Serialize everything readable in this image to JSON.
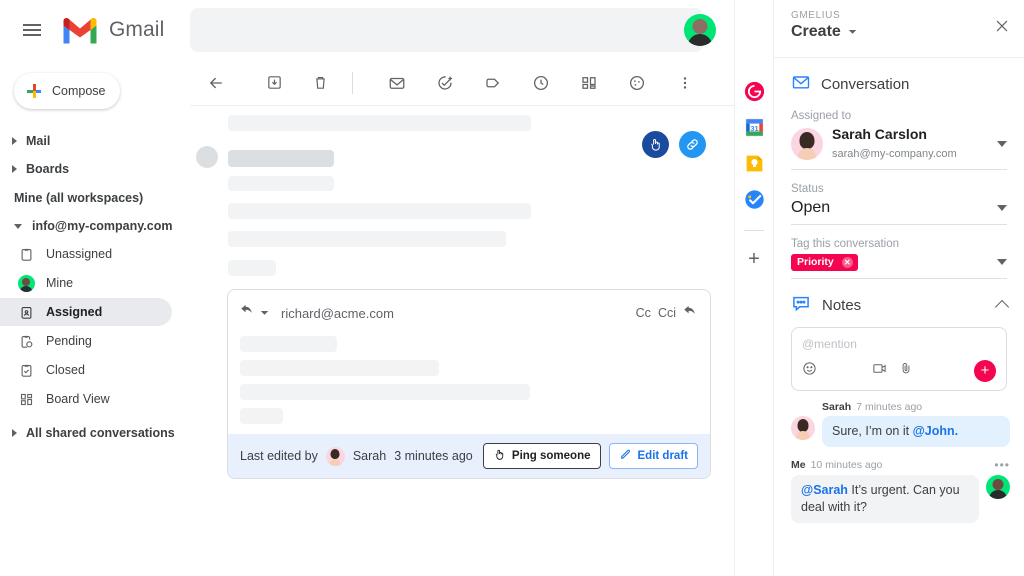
{
  "colors": {
    "gmail_red": "#EA4335",
    "gmail_blue": "#4285F4",
    "gmail_green": "#34A853",
    "gmail_yellow": "#FBBC05",
    "accent_pink": "#F5054F",
    "accent_blue": "#1A73E8",
    "panel_border": "#ECEFF1",
    "badge_dark": "#1A4B9E",
    "badge_light": "#2196F3"
  },
  "topbar": {
    "menu_icon": "hamburger-icon",
    "logo_icon": "gmail-logo-icon",
    "brand": "Gmail",
    "search_value": "",
    "search_placeholder": "",
    "avatar_icon": "account-avatar"
  },
  "sidebar": {
    "compose_label": "Compose",
    "compose_icon": "plus-icon",
    "groups": [
      {
        "label": "Mail",
        "icon": "chevron-right-icon"
      },
      {
        "label": "Boards",
        "icon": "chevron-right-icon"
      }
    ],
    "section_label": "Mine (all workspaces)",
    "workspace": {
      "label": "info@my-company.com",
      "icon": "chevron-down-icon"
    },
    "items": [
      {
        "label": "Unassigned",
        "icon": "clipboard-icon",
        "active": false
      },
      {
        "label": "Mine",
        "icon": "user-avatar-icon",
        "active": false
      },
      {
        "label": "Assigned",
        "icon": "clipboard-person-icon",
        "active": true
      },
      {
        "label": "Pending",
        "icon": "clipboard-clock-icon",
        "active": false
      },
      {
        "label": "Closed",
        "icon": "clipboard-check-icon",
        "active": false
      },
      {
        "label": "Board View",
        "icon": "board-view-icon",
        "active": false
      }
    ],
    "footer_group": {
      "label": "All shared conversations",
      "icon": "chevron-right-icon"
    }
  },
  "toolbar": {
    "buttons": [
      {
        "name": "back-button",
        "icon": "arrow-left-icon"
      },
      {
        "name": "archive-button",
        "icon": "archive-icon"
      },
      {
        "name": "delete-button",
        "icon": "trash-icon"
      },
      {
        "name": "mark-unread-button",
        "icon": "envelope-icon"
      },
      {
        "name": "assign-button",
        "icon": "check-circle-plus-icon"
      },
      {
        "name": "label-button",
        "icon": "tag-icon"
      },
      {
        "name": "snooze-button",
        "icon": "clock-icon"
      },
      {
        "name": "board-button",
        "icon": "kanban-icon"
      },
      {
        "name": "sequence-button",
        "icon": "palette-icon"
      },
      {
        "name": "more-button",
        "icon": "more-vertical-icon"
      }
    ]
  },
  "thread": {
    "badges": [
      {
        "name": "ping-badge",
        "icon": "ping-hand-icon"
      },
      {
        "name": "shared-link-badge",
        "icon": "link-icon"
      }
    ]
  },
  "draft": {
    "reply_icon": "reply-arrow-icon",
    "reply_caret_icon": "chevron-down-icon",
    "recipient": "richard@acme.com",
    "cc_label": "Cc",
    "bcc_label": "Cci",
    "reply_all_icon": "reply-arrow-icon",
    "footer_text_before": "Last edited by",
    "footer_author": "Sarah",
    "footer_text_after": "3 minutes ago",
    "ping_button": {
      "label": "Ping someone",
      "icon": "ping-hand-icon"
    },
    "edit_button": {
      "label": "Edit draft",
      "icon": "pencil-icon"
    }
  },
  "rail": {
    "items": [
      {
        "name": "gmelius-addon",
        "icon": "gmelius-icon"
      },
      {
        "name": "google-calendar-addon",
        "icon": "calendar-31-icon"
      },
      {
        "name": "google-keep-addon",
        "icon": "keep-bulb-icon"
      },
      {
        "name": "google-tasks-addon",
        "icon": "tasks-icon"
      }
    ],
    "add_label": "+",
    "add_icon": "plus-icon"
  },
  "panel": {
    "brand": "GMELIUS",
    "title": "Create",
    "title_caret_icon": "chevron-down-icon",
    "close_icon": "close-icon",
    "conversation": {
      "label": "Conversation",
      "icon": "envelope-icon"
    },
    "assigned": {
      "label": "Assigned to",
      "name": "Sarah Carslon",
      "email": "sarah@my-company.com",
      "avatar_icon": "user-avatar-icon",
      "caret_icon": "chevron-down-icon"
    },
    "status": {
      "label": "Status",
      "value": "Open",
      "caret_icon": "chevron-down-icon"
    },
    "tag": {
      "label": "Tag this conversation",
      "chip": "Priority",
      "chip_color": "#F5054F",
      "remove_icon": "close-circle-icon",
      "caret_icon": "chevron-down-icon"
    },
    "notes": {
      "title": "Notes",
      "icon": "comment-icon",
      "collapse_icon": "chevron-up-icon",
      "input_placeholder": "@mention",
      "emoji_icon": "emoji-icon",
      "video_icon": "video-icon",
      "attach_icon": "paperclip-icon",
      "submit_icon": "plus-icon",
      "messages": [
        {
          "author": "Sarah",
          "time": "7 minutes ago",
          "text_before": "Sure, I’m on it ",
          "mention": "@John.",
          "text_after": "",
          "side": "left",
          "avatar_icon": "sarah-avatar",
          "bubble": "blue"
        },
        {
          "author": "Me",
          "time": "10 minutes ago",
          "mention": "@Sarah",
          "text_before": "",
          "text_after": " It’s urgent. Can you deal with it?",
          "side": "right",
          "avatar_icon": "me-avatar",
          "bubble": "grey",
          "more_icon": "more-horizontal-icon"
        }
      ]
    }
  }
}
